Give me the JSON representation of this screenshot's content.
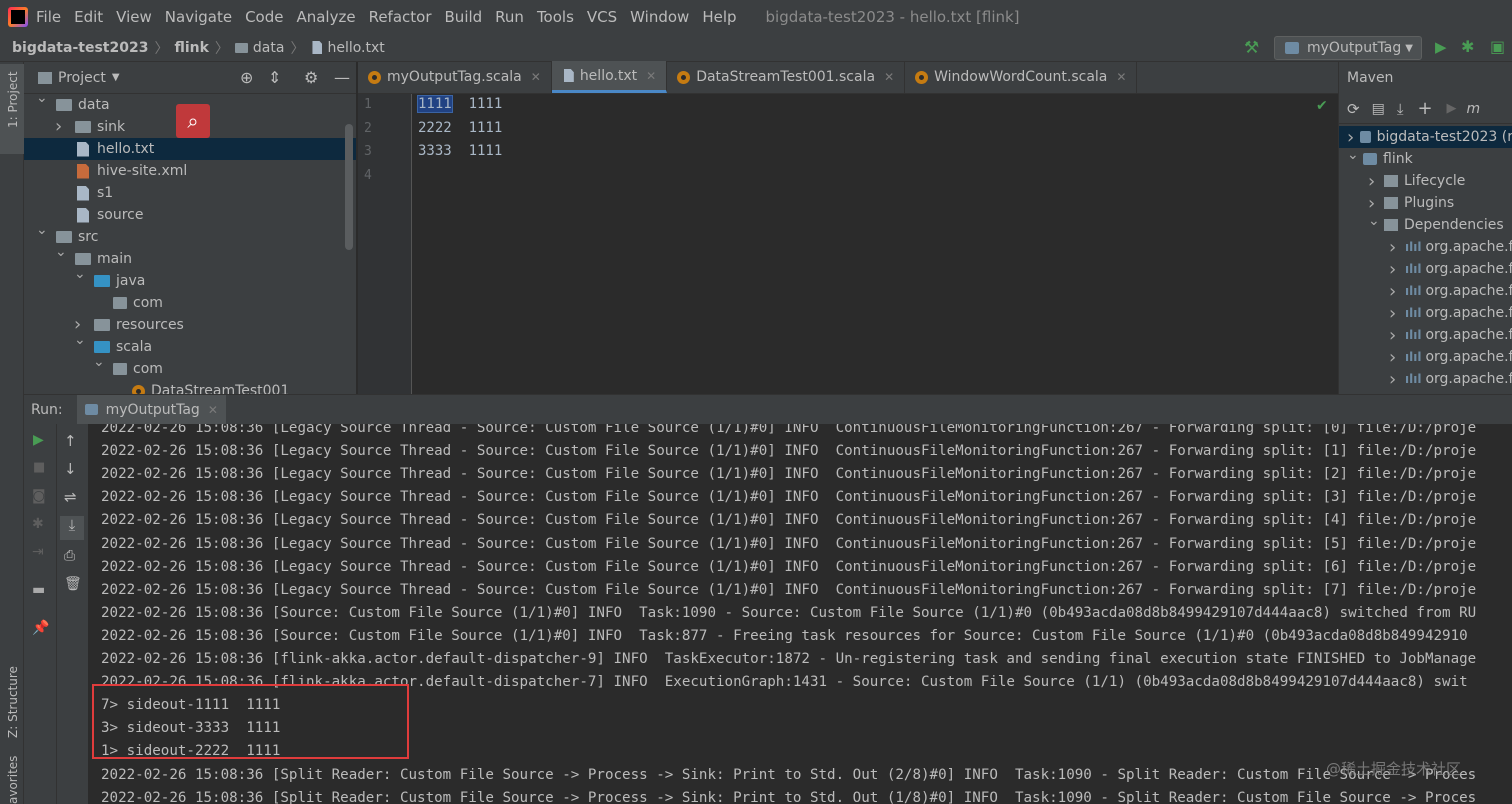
{
  "menubar": {
    "items": [
      "File",
      "Edit",
      "View",
      "Navigate",
      "Code",
      "Analyze",
      "Refactor",
      "Build",
      "Run",
      "Tools",
      "VCS",
      "Window",
      "Help"
    ],
    "window_title": "bigdata-test2023 - hello.txt [flink]"
  },
  "breadcrumb": {
    "items": [
      "bigdata-test2023",
      "flink",
      "data",
      "hello.txt"
    ],
    "run_config": "myOutputTag"
  },
  "left_tool": {
    "project_label": "1: Project",
    "structure_label": "Z: Structure",
    "favorites_label": "avorites"
  },
  "project": {
    "header": "Project",
    "tree": [
      {
        "label": "data",
        "indent": 2,
        "kind": "folder",
        "expanded": true
      },
      {
        "label": "sink",
        "indent": 3,
        "kind": "folder",
        "expanded": false
      },
      {
        "label": "hello.txt",
        "indent": 3,
        "kind": "file",
        "selected": true
      },
      {
        "label": "hive-site.xml",
        "indent": 3,
        "kind": "xml"
      },
      {
        "label": "s1",
        "indent": 3,
        "kind": "file"
      },
      {
        "label": "source",
        "indent": 3,
        "kind": "file"
      },
      {
        "label": "src",
        "indent": 2,
        "kind": "folder",
        "expanded": true
      },
      {
        "label": "main",
        "indent": 3,
        "kind": "folder",
        "expanded": true
      },
      {
        "label": "java",
        "indent": 4,
        "kind": "folder-blue",
        "expanded": true
      },
      {
        "label": "com",
        "indent": 5,
        "kind": "package"
      },
      {
        "label": "resources",
        "indent": 4,
        "kind": "folder",
        "expanded": false
      },
      {
        "label": "scala",
        "indent": 4,
        "kind": "folder-blue",
        "expanded": true
      },
      {
        "label": "com",
        "indent": 5,
        "kind": "package",
        "expanded": true
      },
      {
        "label": "DataStreamTest001",
        "indent": 6,
        "kind": "scala"
      }
    ]
  },
  "tabs": [
    {
      "label": "myOutputTag.scala",
      "icon": "scala-icon",
      "active": false
    },
    {
      "label": "hello.txt",
      "icon": "text-file-icon",
      "active": true
    },
    {
      "label": "DataStreamTest001.scala",
      "icon": "scala-icon",
      "active": false
    },
    {
      "label": "WindowWordCount.scala",
      "icon": "scala-icon",
      "active": false
    }
  ],
  "editor": {
    "line_numbers": [
      "1",
      "2",
      "3",
      "4"
    ],
    "lines": [
      {
        "first": "1111",
        "rest": "  1111"
      },
      {
        "first": "2222",
        "rest": "  1111"
      },
      {
        "first": "3333",
        "rest": "  1111"
      },
      {
        "first": "",
        "rest": ""
      }
    ]
  },
  "maven": {
    "title": "Maven",
    "items": [
      {
        "label": "bigdata-test2023 (r",
        "level": 0,
        "arrow": "right"
      },
      {
        "label": "flink",
        "level": 0,
        "arrow": "down"
      },
      {
        "label": "Lifecycle",
        "level": 1,
        "arrow": "right"
      },
      {
        "label": "Plugins",
        "level": 1,
        "arrow": "right"
      },
      {
        "label": "Dependencies",
        "level": 1,
        "arrow": "down"
      },
      {
        "label": "org.apache.fli",
        "level": 2,
        "arrow": "right"
      },
      {
        "label": "org.apache.fli",
        "level": 2,
        "arrow": "right"
      },
      {
        "label": "org.apache.fli",
        "level": 2,
        "arrow": "right"
      },
      {
        "label": "org.apache.fli",
        "level": 2,
        "arrow": "right"
      },
      {
        "label": "org.apache.fli",
        "level": 2,
        "arrow": "right"
      },
      {
        "label": "org.apache.fli",
        "level": 2,
        "arrow": "right"
      },
      {
        "label": "org.apache.fli",
        "level": 2,
        "arrow": "right"
      }
    ]
  },
  "run": {
    "label": "Run:",
    "tab": "myOutputTag",
    "console": [
      "2022-02-26 15:08:36 [Legacy Source Thread - Source: Custom File Source (1/1)#0] INFO  ContinuousFileMonitoringFunction:267 - Forwarding split: [0] file:/D:/proje",
      "2022-02-26 15:08:36 [Legacy Source Thread - Source: Custom File Source (1/1)#0] INFO  ContinuousFileMonitoringFunction:267 - Forwarding split: [1] file:/D:/proje",
      "2022-02-26 15:08:36 [Legacy Source Thread - Source: Custom File Source (1/1)#0] INFO  ContinuousFileMonitoringFunction:267 - Forwarding split: [2] file:/D:/proje",
      "2022-02-26 15:08:36 [Legacy Source Thread - Source: Custom File Source (1/1)#0] INFO  ContinuousFileMonitoringFunction:267 - Forwarding split: [3] file:/D:/proje",
      "2022-02-26 15:08:36 [Legacy Source Thread - Source: Custom File Source (1/1)#0] INFO  ContinuousFileMonitoringFunction:267 - Forwarding split: [4] file:/D:/proje",
      "2022-02-26 15:08:36 [Legacy Source Thread - Source: Custom File Source (1/1)#0] INFO  ContinuousFileMonitoringFunction:267 - Forwarding split: [5] file:/D:/proje",
      "2022-02-26 15:08:36 [Legacy Source Thread - Source: Custom File Source (1/1)#0] INFO  ContinuousFileMonitoringFunction:267 - Forwarding split: [6] file:/D:/proje",
      "2022-02-26 15:08:36 [Legacy Source Thread - Source: Custom File Source (1/1)#0] INFO  ContinuousFileMonitoringFunction:267 - Forwarding split: [7] file:/D:/proje",
      "2022-02-26 15:08:36 [Source: Custom File Source (1/1)#0] INFO  Task:1090 - Source: Custom File Source (1/1)#0 (0b493acda08d8b8499429107d444aac8) switched from RU",
      "2022-02-26 15:08:36 [Source: Custom File Source (1/1)#0] INFO  Task:877 - Freeing task resources for Source: Custom File Source (1/1)#0 (0b493acda08d8b849942910",
      "2022-02-26 15:08:36 [flink-akka.actor.default-dispatcher-9] INFO  TaskExecutor:1872 - Un-registering task and sending final execution state FINISHED to JobManage",
      "2022-02-26 15:08:36 [flink-akka.actor.default-dispatcher-7] INFO  ExecutionGraph:1431 - Source: Custom File Source (1/1) (0b493acda08d8b8499429107d444aac8) swit",
      "7> sideout-1111  1111",
      "3> sideout-3333  1111",
      "1> sideout-2222  1111",
      "2022-02-26 15:08:36 [Split Reader: Custom File Source -> Process -> Sink: Print to Std. Out (2/8)#0] INFO  Task:1090 - Split Reader: Custom File Source -> Proces",
      "2022-02-26 15:08:36 [Split Reader: Custom File Source -> Process -> Sink: Print to Std. Out (1/8)#0] INFO  Task:1090 - Split Reader: Custom File Source -> Proces"
    ]
  },
  "watermark": "@稀土掘金技术社区",
  "colors": {
    "accent": "#4a88c7",
    "highlight_box": "#e03c3c",
    "run_green": "#499c54",
    "selection": "#0d293e"
  }
}
